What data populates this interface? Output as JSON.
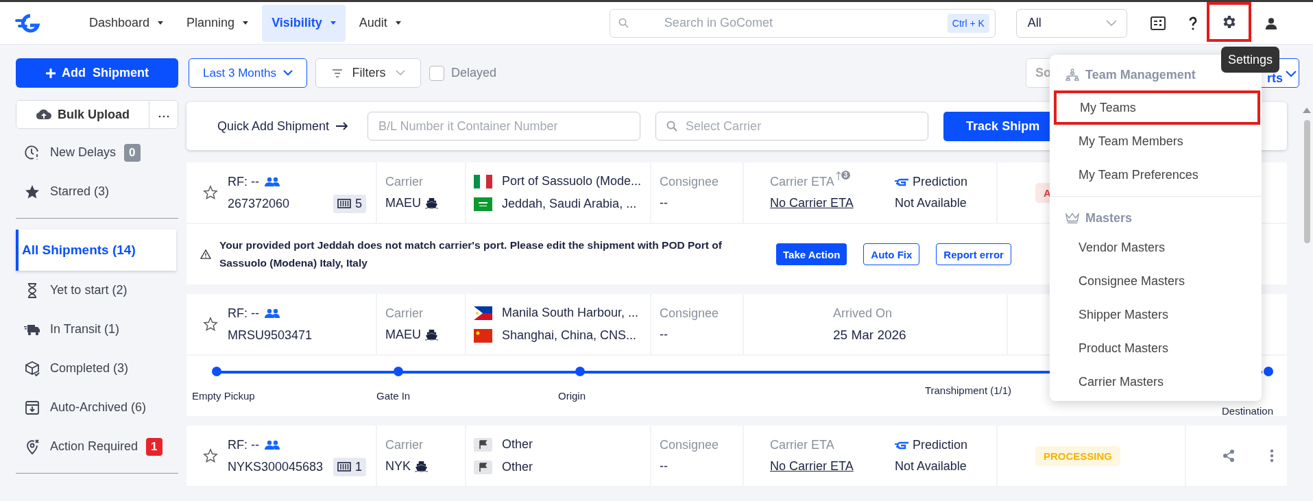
{
  "top_nav": {
    "items": [
      {
        "label": "Dashboard",
        "selected": false
      },
      {
        "label": "Planning",
        "selected": false
      },
      {
        "label": "Visibility",
        "selected": true
      },
      {
        "label": "Audit",
        "selected": false
      }
    ],
    "search": {
      "placeholder": "Search in GoComet",
      "shortcut": "Ctrl + K"
    },
    "scope_select": {
      "value": "All"
    },
    "settings_highlighted": true,
    "tooltip": "Settings"
  },
  "sidebar": {
    "add_button": "Add  Shipment",
    "bulk_upload": "Bulk Upload",
    "groups": [
      {
        "items": [
          {
            "label": "New Delays",
            "selected": false,
            "badge": {
              "text": "0",
              "color": "#8a919c"
            }
          },
          {
            "label": "Starred (3)",
            "selected": false
          }
        ]
      },
      {
        "items": [
          {
            "label": "All Shipments (14)",
            "selected": true
          },
          {
            "label": "Yet to start (2)",
            "selected": false
          },
          {
            "label": "In Transit (1)",
            "selected": false
          },
          {
            "label": "Completed (3)",
            "selected": false
          },
          {
            "label": "Auto-Archived (6)",
            "selected": false
          },
          {
            "label": "Action Required",
            "selected": false,
            "badge": {
              "text": "1",
              "color": "#e5252a"
            }
          }
        ]
      }
    ]
  },
  "toolbar": {
    "period": "Last 3 Months",
    "filters": "Filters",
    "delayed": {
      "label": "Delayed",
      "checked": false
    },
    "sort_field": "So",
    "sort_button": "rts"
  },
  "quick_add": {
    "label": "Quick Add Shipment",
    "bl_placeholder": "B/L Number it Container Number",
    "carrier_placeholder": "Select Carrier",
    "button": "Track Shipm"
  },
  "shipments": [
    {
      "starred": false,
      "ref": "RF: --",
      "id": "267372060",
      "containers": "5",
      "carrier_label": "Carrier",
      "carrier": "MAEU",
      "origin": "Port of Sassuolo (Mode...",
      "destination": "Jeddah, Saudi Arabia, ...",
      "consignee_label": "Consignee",
      "consignee": "--",
      "eta": {
        "kind": "eta",
        "label": "Carrier ETA",
        "count": "3",
        "value": "No Carrier ETA"
      },
      "prediction": {
        "label": "Prediction",
        "value": "Not Available"
      },
      "status": {
        "text": "A",
        "color": "#e5383b"
      },
      "alert": {
        "text": "Your provided port Jeddah does not match carrier's port. Please edit the shipment with POD Port of Sassuolo (Modena) Italy, Italy",
        "actions": [
          {
            "label": "Take Action",
            "kind": "primary"
          },
          {
            "label": "Auto Fix",
            "kind": "outline"
          },
          {
            "label": "Report error",
            "kind": "outline"
          }
        ]
      }
    },
    {
      "starred": false,
      "ref": "RF: --",
      "id": "MRSU9503471",
      "carrier_label": "Carrier",
      "carrier": "MAEU",
      "origin": "Manila South Harbour, ...",
      "destination": "Shanghai, China, CNS...",
      "consignee_label": "Consignee",
      "consignee": "--",
      "eta": {
        "kind": "arrived",
        "label": "Arrived On",
        "value": "25 Mar 2026"
      },
      "timeline": [
        {
          "label": "Empty Pickup",
          "dot": true
        },
        {
          "label": "Gate In",
          "dot": true
        },
        {
          "label": "Origin",
          "dot": true
        },
        {
          "label": "Transhipment (1/1)",
          "dot": false
        },
        {
          "label": "Destination",
          "dot": true
        }
      ]
    },
    {
      "starred": false,
      "ref": "RF: --",
      "id": "NYKS300045683",
      "containers": "1",
      "carrier_label": "Carrier",
      "carrier": "NYK",
      "origin": "Other",
      "destination": "Other",
      "consignee_label": "Consignee",
      "consignee": "--",
      "eta": {
        "kind": "eta",
        "label": "Carrier ETA",
        "value": "No Carrier ETA"
      },
      "prediction": {
        "label": "Prediction",
        "value": "Not Available"
      },
      "status": {
        "text": "PROCESSING",
        "color": "#f5b400"
      },
      "actions": true
    }
  ],
  "settings_menu": {
    "sections": [
      {
        "title": "Team Management",
        "items": [
          {
            "label": "My Teams",
            "highlighted": true
          },
          {
            "label": "My Team Members",
            "highlighted": false
          },
          {
            "label": "My Team Preferences",
            "highlighted": false
          }
        ]
      },
      {
        "title": "Masters",
        "items": [
          {
            "label": "Vendor Masters",
            "highlighted": false
          },
          {
            "label": "Consignee Masters",
            "highlighted": false
          },
          {
            "label": "Shipper Masters",
            "highlighted": false
          },
          {
            "label": "Product Masters",
            "highlighted": false
          },
          {
            "label": "Carrier Masters",
            "highlighted": false
          }
        ]
      }
    ]
  }
}
